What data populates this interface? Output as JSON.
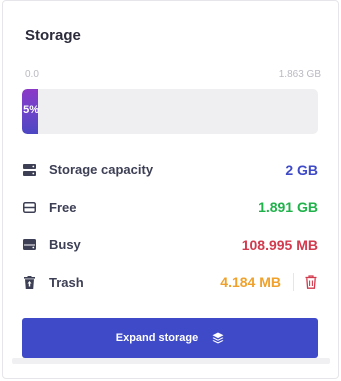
{
  "card": {
    "title": "Storage",
    "scale_min": "0.0",
    "scale_max": "1.863 GB",
    "usage_fraction": 0.05,
    "usage_label": "5%"
  },
  "rows": [
    {
      "label": "Storage capacity",
      "value": "2 GB",
      "color": "#3e4ac7",
      "icon": "server-icon"
    },
    {
      "label": "Free",
      "value": "1.891 GB",
      "color": "#1fb24a",
      "icon": "drive-empty-icon"
    },
    {
      "label": "Busy",
      "value": "108.995 MB",
      "color": "#d23a4e",
      "icon": "drive-full-icon"
    },
    {
      "label": "Trash",
      "value": "4.184 MB",
      "color": "#f0a12b",
      "icon": "trash-restore-icon"
    }
  ],
  "actions": {
    "expand_label": "Expand storage",
    "expand_icon": "layers-icon",
    "empty_trash_icon": "trash-icon"
  },
  "colors": {
    "accent": "#3e4ac7",
    "danger": "#d23a4e"
  }
}
